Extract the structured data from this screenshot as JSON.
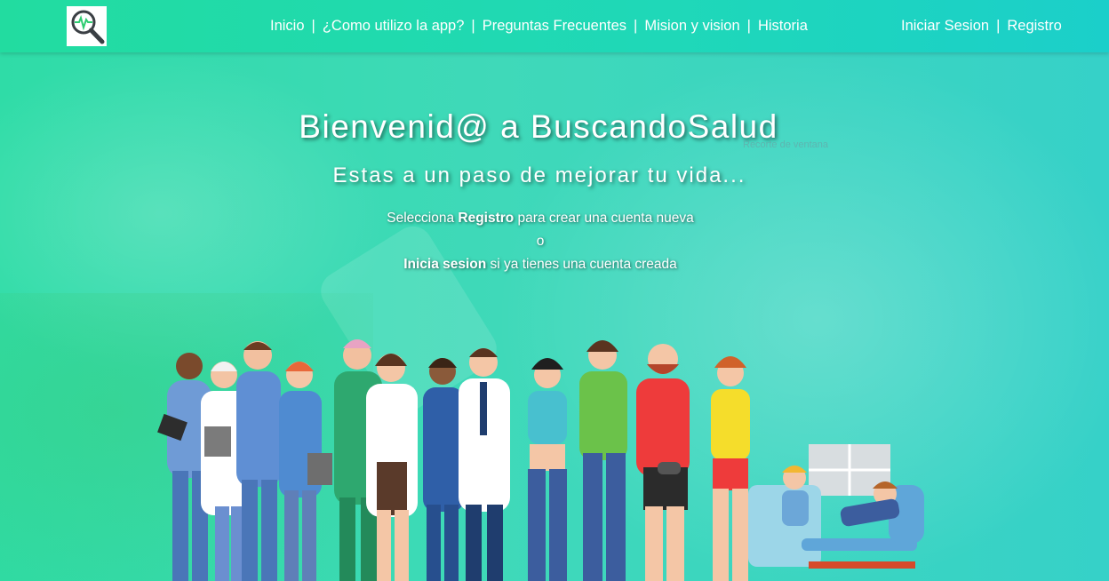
{
  "brand": {
    "logo_icon": "magnifier-heartbeat-icon"
  },
  "nav": {
    "links": [
      "Inicio",
      "¿Como utilizo la app?",
      "Preguntas Frecuentes",
      "Mision y vision",
      "Historia"
    ],
    "separator": "|"
  },
  "auth": {
    "login": "Iniciar Sesion",
    "register": "Registro",
    "separator": "|"
  },
  "hero": {
    "title": "Bienvenid@ a BuscandoSalud",
    "subtitle": "Estas a un paso de mejorar tu vida...",
    "line1_pre": "Selecciona ",
    "line1_bold": "Registro",
    "line1_post": " para crear una cuenta nueva",
    "line2": "o",
    "line3_bold": "Inicia sesion",
    "line3_post": " si ya tienes una cuenta creada",
    "faint_text": "Recorte de ventana"
  },
  "colors": {
    "accent": "#1fd8b8",
    "gradient_start": "#22dca0",
    "gradient_end": "#1bcfca"
  }
}
